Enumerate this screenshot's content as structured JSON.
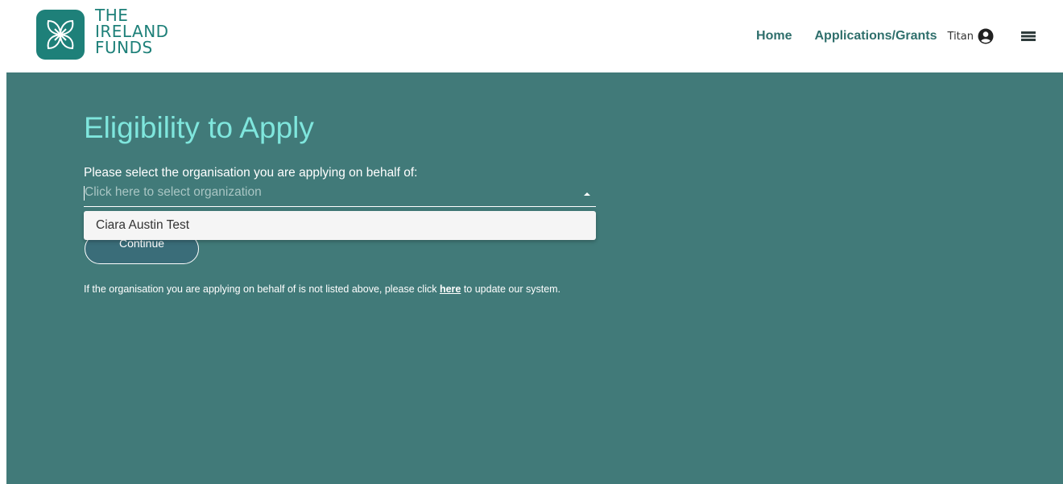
{
  "logo": {
    "lines": [
      "THE",
      "IRELAND",
      "FUNDS"
    ]
  },
  "nav": {
    "home": "Home",
    "applications": "Applications/Grants",
    "user_name": "Titan"
  },
  "page": {
    "title": "Eligibility to Apply",
    "select_label": "Please select the organisation you are applying on behalf of:",
    "select_placeholder": "Click here to select organization",
    "dropdown_options": [
      "Ciara Austin Test"
    ],
    "continue_label": "Continue",
    "info_before": "If the organisation you are applying on behalf of is not listed above, please click ",
    "info_link": "here",
    "info_after": " to update our system."
  },
  "colors": {
    "brand_teal": "#1e8079",
    "nav_text": "#2f6f6c",
    "main_background": "#417a79",
    "title_color": "#7fe6dd"
  },
  "icons": {
    "logo": "shamrock-knot-icon",
    "user": "user-circle-icon",
    "menu": "hamburger-menu-icon",
    "select_arrow": "caret-up-icon"
  }
}
